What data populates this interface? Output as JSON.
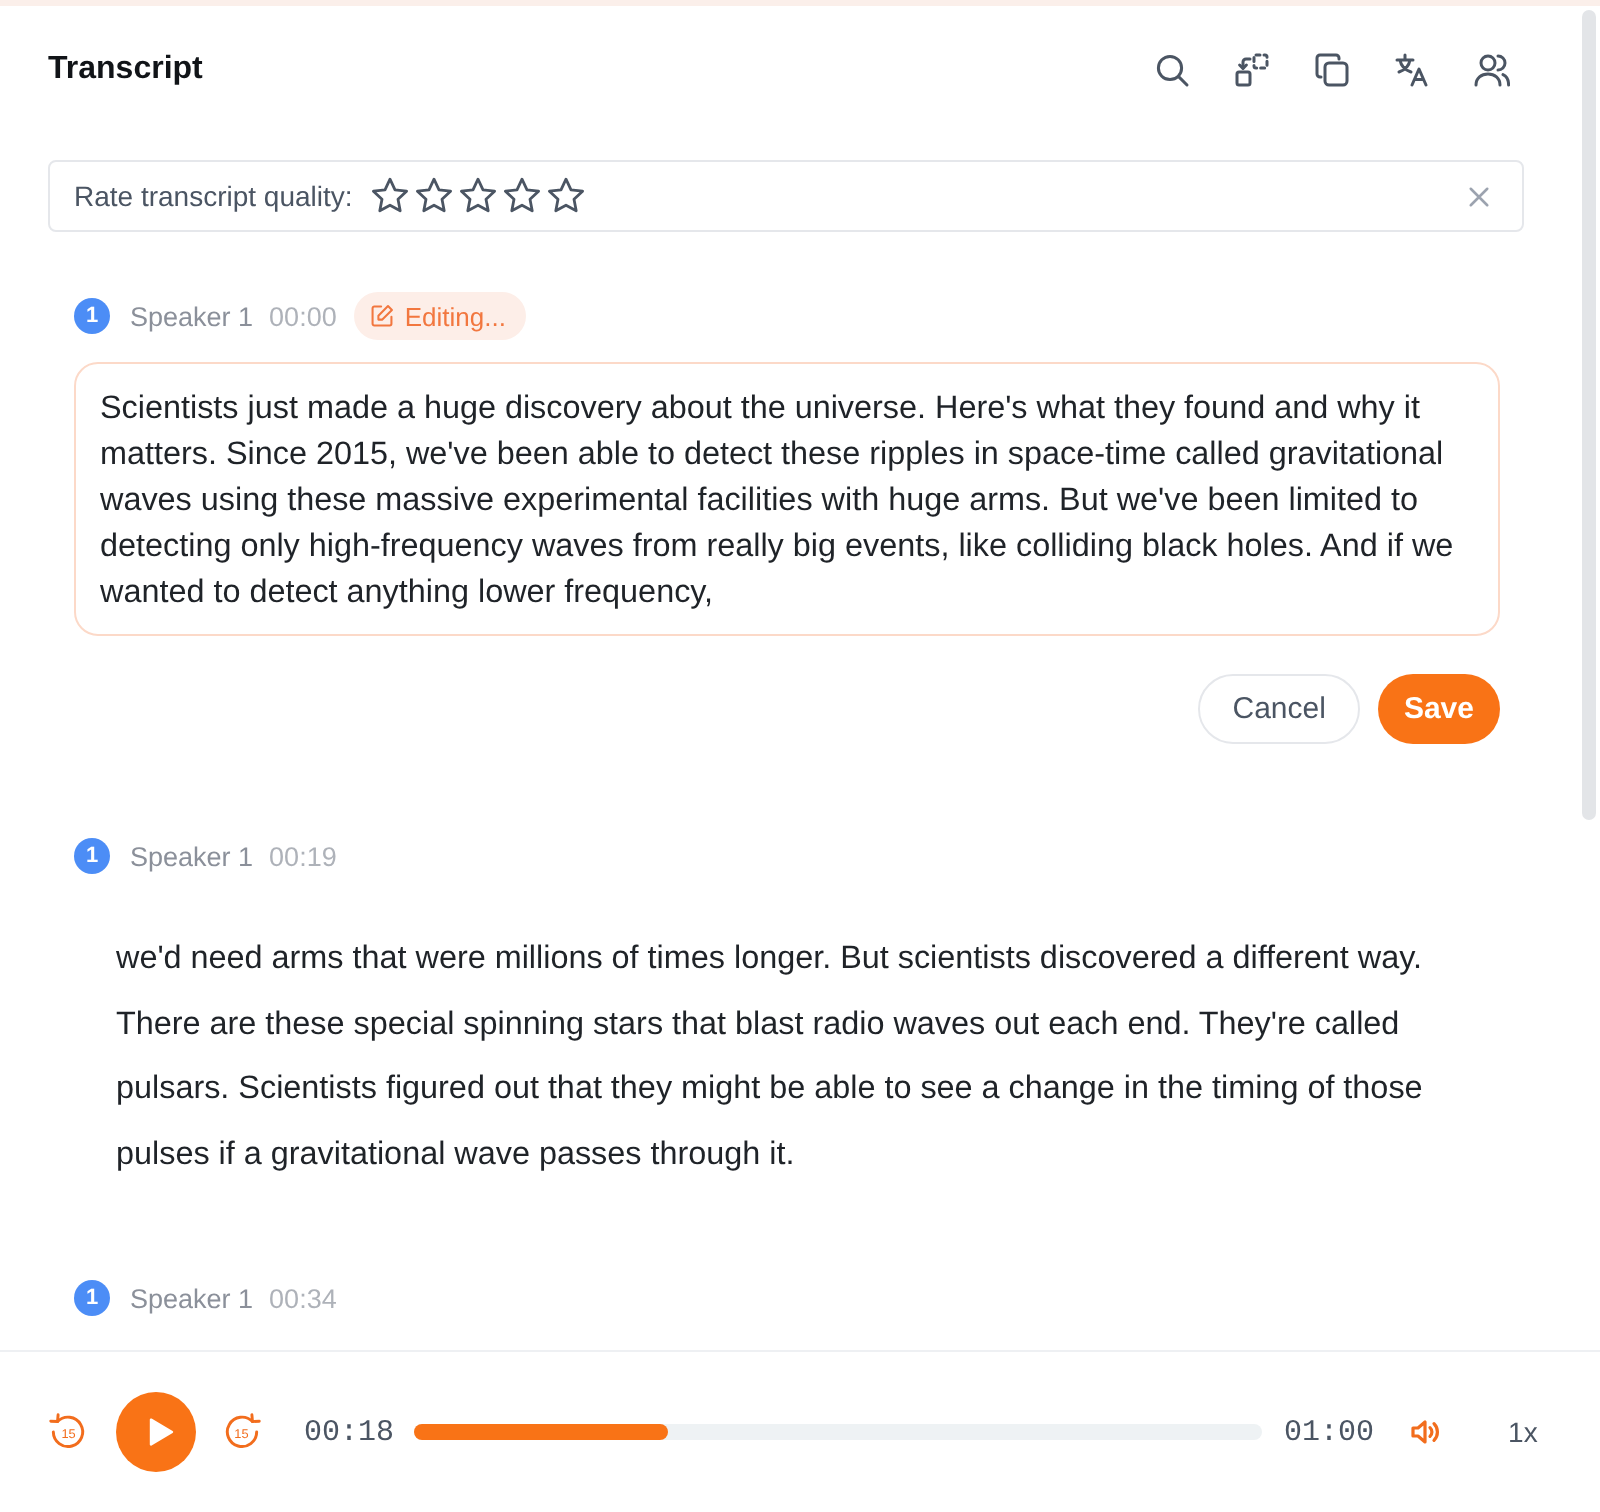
{
  "header": {
    "title": "Transcript"
  },
  "rating": {
    "label": "Rate transcript quality:",
    "stars": 0
  },
  "segments": [
    {
      "speaker_number": "1",
      "speaker": "Speaker 1",
      "time": "00:00",
      "editing": true,
      "status": "Editing...",
      "text": "Scientists just made a huge discovery about the universe. Here's what they found and why it matters. Since 2015, we've been able to detect these ripples in space-time called gravitational waves using these massive experimental facilities with huge arms. But we've been limited to detecting only high-frequency waves from really big events, like colliding black holes. And if we wanted to detect anything lower frequency,",
      "actions": [
        {
          "label": "Cancel",
          "kind": "secondary"
        },
        {
          "label": "Save",
          "kind": "primary"
        }
      ]
    },
    {
      "speaker_number": "1",
      "speaker": "Speaker 1",
      "time": "00:19",
      "editing": false,
      "text": "we'd need arms that were millions of times longer. But scientists discovered a different way. There are these special spinning stars that blast radio waves out each end. They're called pulsars. Scientists figured out that they might be able to see a change in the timing of those pulses if a gravitational wave passes through it."
    },
    {
      "speaker_number": "1",
      "speaker": "Speaker 1",
      "time": "00:34",
      "editing": false
    }
  ],
  "player": {
    "skip_back": "15",
    "playing": false,
    "skip_forward": "15",
    "elapsed": "00:18",
    "level": 0.3,
    "duration": "01:00",
    "speed": "1x"
  }
}
